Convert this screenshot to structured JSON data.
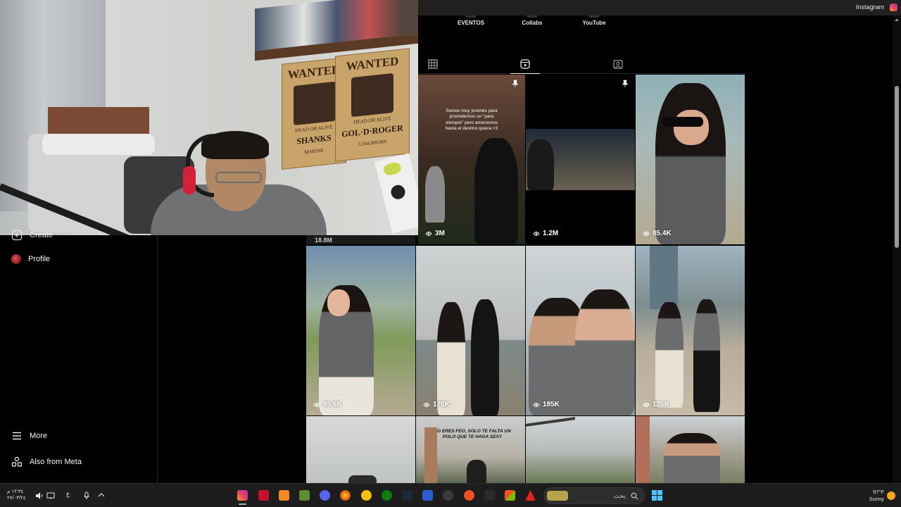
{
  "window": {
    "title": "Instagram"
  },
  "highlights": [
    "EVENTOS",
    "Collabs",
    "YouTube"
  ],
  "tabs": [
    {
      "name": "posts",
      "icon": "grid-icon",
      "active": false
    },
    {
      "name": "reels",
      "icon": "reels-icon",
      "active": true
    },
    {
      "name": "tagged",
      "icon": "tagged-icon",
      "active": false
    }
  ],
  "posts": [
    {
      "views": "3M",
      "pinned": true,
      "caption": "Somos muy jovenes para prometernos un \"para siempre\" pero amemonos hasta el destino quiera <3"
    },
    {
      "views": "1.2M",
      "pinned": true,
      "caption": ""
    },
    {
      "views": "85.4K",
      "pinned": false,
      "caption": ""
    },
    {
      "views": "85.6K",
      "pinned": false,
      "caption": ""
    },
    {
      "views": "176K",
      "pinned": false,
      "caption": ""
    },
    {
      "views": "185K",
      "pinned": false,
      "caption": ""
    },
    {
      "views": "126K",
      "pinned": false,
      "caption": ""
    },
    {
      "views": "",
      "pinned": false,
      "caption": ""
    },
    {
      "views": "",
      "pinned": false,
      "caption": "NO ERES FEO, SOLO TE FALTA UN POLO QUE TE HAGA SEXY"
    },
    {
      "views": "",
      "pinned": false,
      "caption": ""
    },
    {
      "views": "",
      "pinned": false,
      "caption": ""
    }
  ],
  "partial_views_label": "18.8M",
  "sidebar": {
    "partial_item": "Create",
    "profile": "Profile",
    "more": "More",
    "also_from_meta": "Also from Meta"
  },
  "webcam": {
    "poster1": {
      "title": "WANTED",
      "sub": "DEAD OR ALIVE",
      "name": "SHANKS",
      "bounty": "MARINE"
    },
    "poster2": {
      "title": "WANTED",
      "sub": "DEAD OR ALIVE",
      "name": "GOL·D·ROGER",
      "bounty": "5,564,800,000"
    }
  },
  "taskbar": {
    "clock_time": "١٢:٣٤ م",
    "clock_date": "٢٧/٠٣/٢٤",
    "language": "ع",
    "search_text": "بحث",
    "weather_temp": "97°F",
    "weather_desc": "Sunny",
    "accent": "#4cc2ff"
  }
}
